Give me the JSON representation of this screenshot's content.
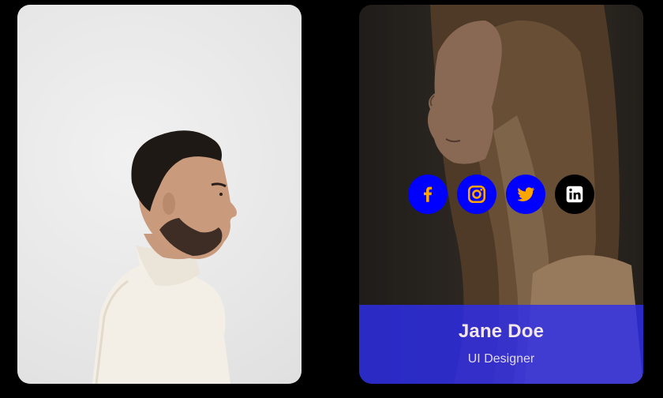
{
  "cards": [
    {
      "photo_icon": "man-profile-photo"
    },
    {
      "photo_icon": "woman-profile-photo",
      "name": "Jane Doe",
      "role": "UI Designer",
      "social": [
        {
          "icon": "facebook-icon",
          "bg": "#0000ff",
          "fg": "#ffa500"
        },
        {
          "icon": "instagram-icon",
          "bg": "#0000ff",
          "fg": "#ffa500"
        },
        {
          "icon": "twitter-icon",
          "bg": "#0000ff",
          "fg": "#ffa500"
        },
        {
          "icon": "linkedin-icon",
          "bg": "#000000",
          "fg": "#ffffff"
        }
      ]
    }
  ],
  "colors": {
    "page_background": "#000000",
    "info_panel": "#2d2deb",
    "social_accent": "#ffa500"
  }
}
